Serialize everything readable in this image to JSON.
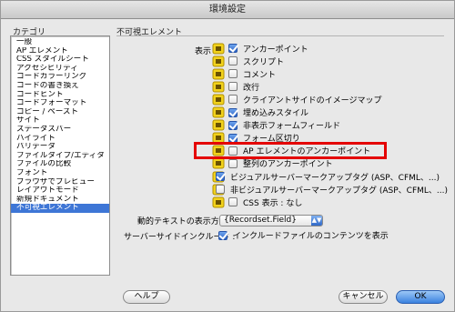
{
  "window": {
    "title": "環境設定"
  },
  "category": {
    "header": "カテゴリ",
    "items": [
      "一般",
      "AP エレメント",
      "CSS スタイルシート",
      "アクセシビリティ",
      "コードカラーリング",
      "コードの書き換え",
      "コードヒント",
      "コードフォーマット",
      "コピー / ペースト",
      "サイト",
      "ステータスバー",
      "ハイライト",
      "バリデータ",
      "ファイルタイプ/エディタ",
      "ファイルの比較",
      "フォント",
      "ブラウザでプレビュー",
      "レイアウトモード",
      "新規ドキュメント",
      "不可視エレメント"
    ],
    "selected": "不可視エレメント"
  },
  "pane": {
    "header": "不可視エレメント",
    "show_label": "表示 :",
    "options": [
      {
        "label": "アンカーポイント",
        "checked": true,
        "icon": "anchor-icon"
      },
      {
        "label": "スクリプト",
        "checked": false,
        "icon": "script-icon"
      },
      {
        "label": "コメント",
        "checked": false,
        "icon": "comment-icon"
      },
      {
        "label": "改行",
        "checked": false,
        "icon": "line-break-icon"
      },
      {
        "label": "クライアントサイドのイメージマップ",
        "checked": false,
        "icon": "image-map-icon"
      },
      {
        "label": "埋め込みスタイル",
        "checked": true,
        "icon": "embedded-style-icon"
      },
      {
        "label": "非表示フォームフィールド",
        "checked": true,
        "icon": "hidden-field-icon"
      },
      {
        "label": "フォーム区切り",
        "checked": true,
        "icon": "form-delimiter-icon"
      },
      {
        "label": "AP エレメントのアンカーポイント",
        "checked": false,
        "icon": "ap-element-anchor-icon"
      },
      {
        "label": "整列のアンカーポイント",
        "checked": false,
        "icon": "align-anchor-icon"
      },
      {
        "label": "ビジュアルサーバーマークアップタグ (ASP、CFML、...)",
        "checked": true,
        "icon": "visual-server-tag-icon"
      },
      {
        "label": "非ビジュアルサーバーマークアップタグ (ASP、CFML、...)",
        "checked": false,
        "icon": "nonvisual-server-tag-icon"
      },
      {
        "label": "CSS 表示 : なし",
        "checked": false,
        "icon": "css-display-none-icon"
      }
    ],
    "dynamic_text_label": "動的テキストの表示方法 :",
    "dynamic_text_value": "{Recordset.Field}",
    "ssi_label": "サーバーサイドインクルード :",
    "ssi_option": {
      "label": "インクルードファイルのコンテンツを表示",
      "checked": true
    }
  },
  "buttons": {
    "help": "ヘルプ",
    "cancel": "キャンセル",
    "ok": "OK"
  },
  "colors": {
    "selection": "#3e76d6",
    "highlight_box": "#e40000",
    "accent": "#3b82df"
  }
}
